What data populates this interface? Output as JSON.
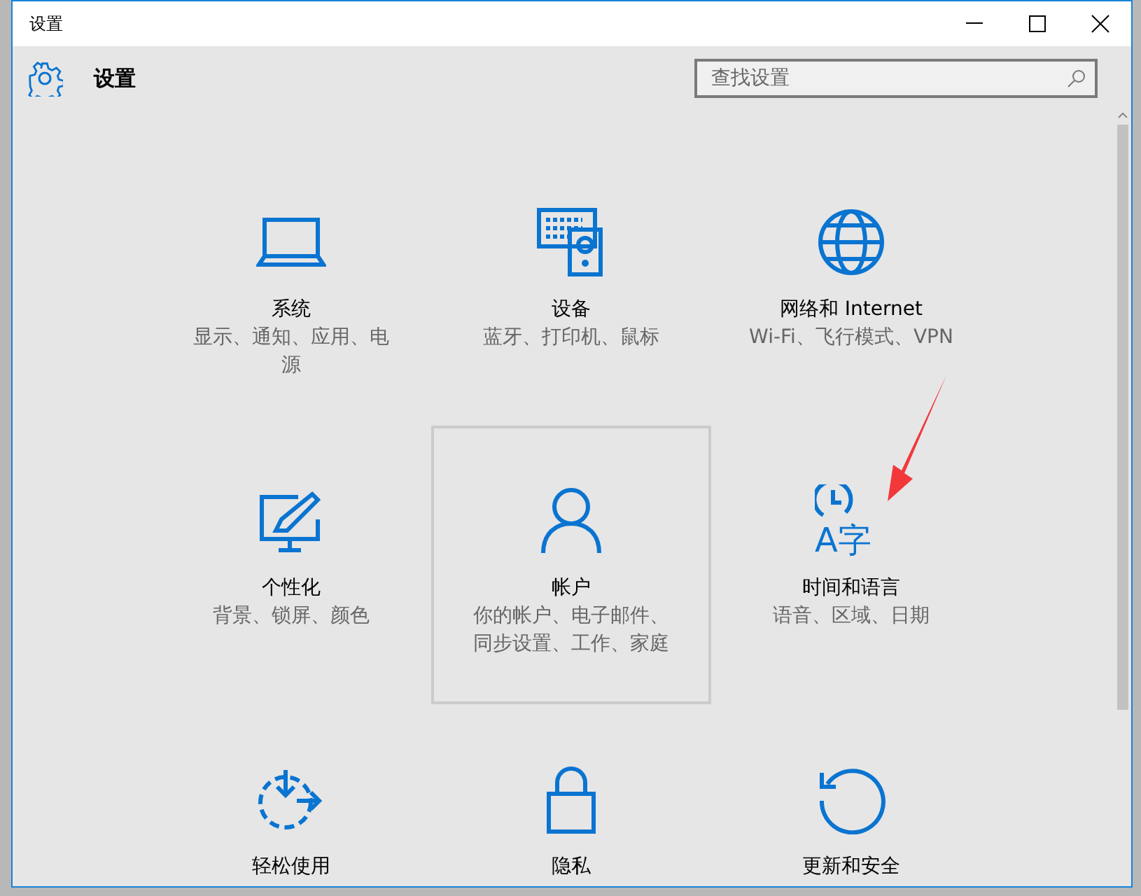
{
  "window": {
    "title": "设置"
  },
  "header": {
    "title": "设置",
    "search": {
      "placeholder": "查找设置"
    }
  },
  "tiles": [
    {
      "title": "系统",
      "description": "显示、通知、应用、电源",
      "selected": false
    },
    {
      "title": "设备",
      "description": "蓝牙、打印机、鼠标",
      "selected": false
    },
    {
      "title": "网络和 Internet",
      "description": "Wi-Fi、飞行模式、VPN",
      "selected": false
    },
    {
      "title": "个性化",
      "description": "背景、锁屏、颜色",
      "selected": false
    },
    {
      "title": "帐户",
      "description": "你的帐户、电子邮件、同步设置、工作、家庭",
      "selected": true
    },
    {
      "title": "时间和语言",
      "description": "语音、区域、日期",
      "selected": false
    },
    {
      "title": "轻松使用",
      "selected": false
    },
    {
      "title": "隐私",
      "selected": false
    },
    {
      "title": "更新和安全",
      "selected": false
    }
  ],
  "language_icon_text": "A字"
}
